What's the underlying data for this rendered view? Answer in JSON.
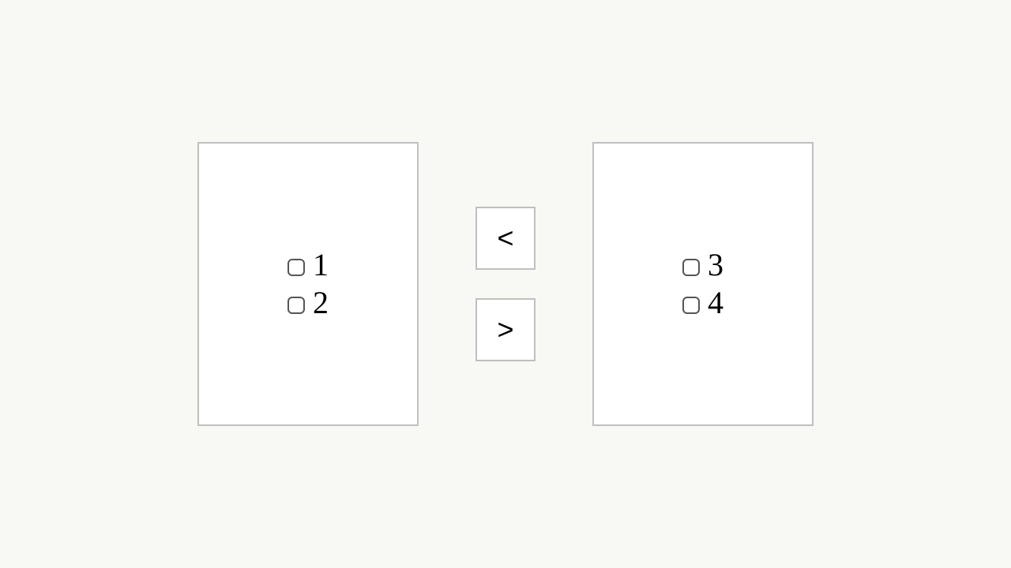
{
  "left_panel": {
    "items": [
      {
        "label": "1",
        "checked": false
      },
      {
        "label": "2",
        "checked": false
      }
    ]
  },
  "controls": {
    "move_left_label": "<",
    "move_right_label": ">"
  },
  "right_panel": {
    "items": [
      {
        "label": "3",
        "checked": false
      },
      {
        "label": "4",
        "checked": false
      }
    ]
  }
}
